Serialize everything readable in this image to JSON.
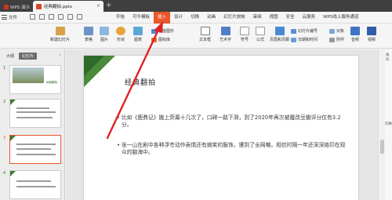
{
  "titlebar": {
    "app_name": "WPS 演示",
    "doc_name": "经典翻拍.pptx"
  },
  "menu": {
    "file_label": "文件",
    "items": [
      "开始",
      "可牛模板",
      "插入",
      "设计",
      "切换",
      "动画",
      "幻灯片放映",
      "审阅",
      "视图",
      "安全",
      "云服务",
      "WPS线上服务通道"
    ],
    "active_index": 2
  },
  "ribbon": {
    "new_slide": "新建幻灯片",
    "table": "表格",
    "image": "图片",
    "shape": "形状",
    "chart": "图表",
    "smart_graphic": "智能图形",
    "icon_lib": "图标库",
    "textbox": "文本框",
    "wordart": "艺术字",
    "symbol": "符号",
    "formula": "公式",
    "header_footer": "页眉和页脚",
    "slide_number": "幻灯片编号",
    "object": "对象",
    "date_time": "日期和时间",
    "attachment": "附件",
    "audio": "音频",
    "video": "视频"
  },
  "leftpanel": {
    "tabs": [
      "大纲",
      "幻灯片"
    ],
    "active_tab": 1,
    "thumbs": [
      {
        "num": "1",
        "caption": "经典翻拍"
      },
      {
        "num": "2"
      },
      {
        "num": "3"
      },
      {
        "num": "4"
      }
    ],
    "selected_index": 2
  },
  "slide": {
    "title": "经典翻拍",
    "bullets": [
      "比如《鹿鼎记》搬上荧幕十几次了，口碑一路下滑，到了2020年再次被魔改豆瓣评分仅有3.2分。",
      "张一山在剧中各种浮夸动作表情还有搞笑的服饰，遭到了全网嘲，相信时隔一年还深深烙印在观众的脑海中。"
    ]
  },
  "rightpane": {
    "label_top": "备份",
    "label_side": "切换"
  },
  "colors": {
    "accent": "#e9572b",
    "slide_green": "#4a8a3a",
    "annotation_red": "#e02020"
  }
}
